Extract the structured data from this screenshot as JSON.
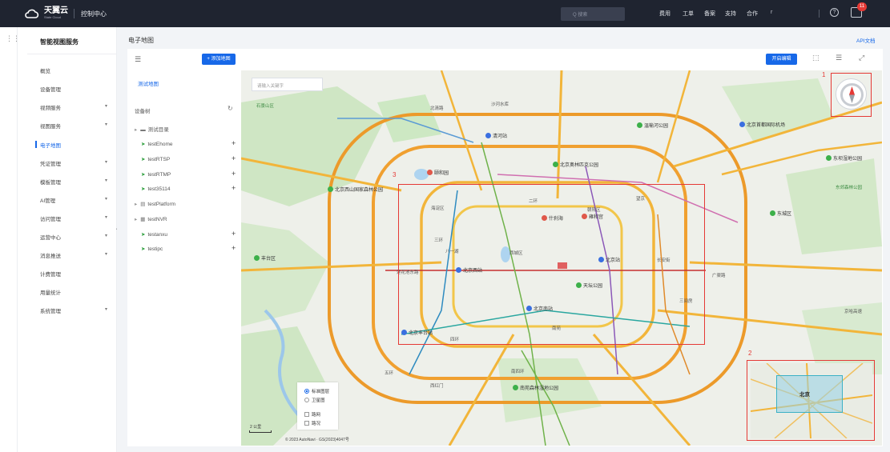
{
  "header": {
    "logo_cn": "天翼云",
    "logo_en": "State Cloud",
    "console": "控制中心",
    "search_placeholder": "Q 搜索",
    "nav": [
      "费用",
      "工单",
      "备案",
      "支持",
      "合作"
    ],
    "user": "r  ",
    "badge": "11"
  },
  "sidebar": {
    "title": "智能视图服务",
    "items": [
      {
        "label": "概览",
        "arrow": ""
      },
      {
        "label": "设备管理",
        "arrow": ""
      },
      {
        "label": "视频服务",
        "arrow": "▾"
      },
      {
        "label": "视图服务",
        "arrow": "▾"
      },
      {
        "label": "电子地图",
        "arrow": ""
      },
      {
        "label": "凭证管理",
        "arrow": "▾"
      },
      {
        "label": "模板管理",
        "arrow": "▾"
      },
      {
        "label": "AI管理",
        "arrow": "▾"
      },
      {
        "label": "访问管理",
        "arrow": "▾"
      },
      {
        "label": "运营中心",
        "arrow": "▾"
      },
      {
        "label": "消息推送",
        "arrow": "▾"
      },
      {
        "label": "计费管理",
        "arrow": ""
      },
      {
        "label": "用量统计",
        "arrow": ""
      },
      {
        "label": "系统管理",
        "arrow": "▾"
      }
    ],
    "active": "电子地图"
  },
  "page": {
    "title": "电子地图",
    "api_doc": "API文档",
    "add_map": "+ 添加地图",
    "open_edit": "开启编辑"
  },
  "tree": {
    "map_tab": "测试地图",
    "header": "设备树",
    "nodes": [
      {
        "label": "测试目录",
        "type": "folder",
        "expand": "▸"
      },
      {
        "label": "testEhome",
        "type": "cam"
      },
      {
        "label": "testRTSP",
        "type": "cam"
      },
      {
        "label": "testRTMP",
        "type": "cam"
      },
      {
        "label": "test35114",
        "type": "cam"
      },
      {
        "label": "testPlatform",
        "type": "platform",
        "expand": "▸"
      },
      {
        "label": "testNVR",
        "type": "nvr",
        "expand": "▸"
      },
      {
        "label": "testanxu",
        "type": "cam"
      },
      {
        "label": "testipc",
        "type": "cam"
      }
    ]
  },
  "map": {
    "search_placeholder": "请输入关键字",
    "layers": {
      "standard": "标准图层",
      "satellite": "卫星图",
      "roadnet": "路网",
      "traffic": "路况",
      "selected": "标准图层"
    },
    "scale": "2 公里",
    "copyright": "© 2023 AutoNavi · GS(2023)4047号",
    "overview_label": "北京",
    "annotations": [
      "1",
      "2",
      "3"
    ],
    "places": {
      "airport": "北京首都国际机场",
      "olympic": "北京奥林匹克公园",
      "summer_palace": "颐和园",
      "xishan": "北京西山国家森林公园",
      "beijing_west": "北京西站",
      "beijing_station": "北京站",
      "beijing_south": "北京南站",
      "fengtai": "北京丰台站",
      "temple_heaven": "天坛公园",
      "shichahai": "什刹海",
      "yonghegong": "雍和宫",
      "chaoyang_park": "东坝湿地公园",
      "wetland": "温榆河公园",
      "nanhaizi": "南苑森林湿地公园",
      "dongjiao": "东郊森林公园",
      "qinghe": "清河站",
      "xicheng": "西城区",
      "dongcheng": "东城区",
      "haidian": "海淀区",
      "chaoyang": "朝阳区",
      "fengtai_d": "丰台区",
      "shijingshan": "石景山区",
      "second_ring": "二环",
      "third_ring": "三环",
      "fourth_ring": "四环",
      "fifth_ring": "五环",
      "changan": "长安街",
      "guangqu": "广渠路",
      "jingha": "京哈高速",
      "nansihuan": "南四环",
      "wangjing": "望京",
      "shahe": "沙河水库",
      "beiqing": "北清路",
      "lianhuachi": "莲花池东路",
      "nanyuan": "南苑",
      "sanjianfang": "三间房",
      "baitasi": "八一湖",
      "xihongmen": "西红门"
    }
  }
}
